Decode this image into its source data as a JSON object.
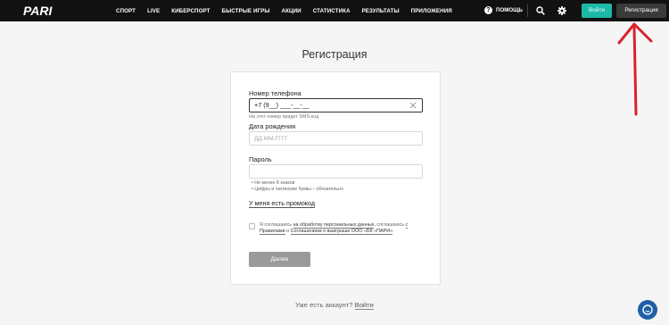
{
  "header": {
    "logo_text": "PARI",
    "nav": [
      "СПОРТ",
      "LIVE",
      "КИБЕРСПОРТ",
      "БЫСТРЫЕ ИГРЫ",
      "АКЦИИ",
      "СТАТИСТИКА",
      "РЕЗУЛЬТАТЫ",
      "ПРИЛОЖЕНИЯ"
    ],
    "help_label": "ПОМОЩЬ",
    "help_icon": "question-circle-icon",
    "search_icon": "search-icon",
    "settings_icon": "gear-icon",
    "login_label": "Войти",
    "register_label": "Регистрация"
  },
  "page": {
    "title": "Регистрация"
  },
  "form": {
    "phone_label": "Номер телефона",
    "phone_value": "+7 (9__) ___-__-__",
    "phone_hint": "На этот номер придет SMS-код",
    "dob_label": "Дата рождения",
    "dob_placeholder": "ДД.ММ.ГГГГ",
    "password_label": "Пароль",
    "password_rules": [
      "Не менее 8 знаков",
      "Цифры и латинские буквы – обязательно"
    ],
    "promo_link": "У меня есть промокод",
    "agree_prefix": "Я соглашаюсь ",
    "agree_link1": "на обработку персональных данных",
    "agree_mid1": ", соглашаюсь ",
    "agree_link2": "с Правилами",
    "agree_mid2": " и ",
    "agree_link3": "Соглашением о выигрыше ООО «БК «ПАРИ»",
    "agree_end": ".",
    "next_label": "Далее"
  },
  "footer": {
    "question": "Уже есть аккаунт? ",
    "login_link": "Войти"
  },
  "colors": {
    "header_bg": "#111111",
    "login_bg": "#1bb9a6",
    "register_bg": "#3a3a3a",
    "next_bg": "#9a9a9a",
    "annotation_arrow": "#d8232a",
    "chat_bg": "#1f5fa8"
  },
  "chat_icon": "chat-bubble-icon"
}
